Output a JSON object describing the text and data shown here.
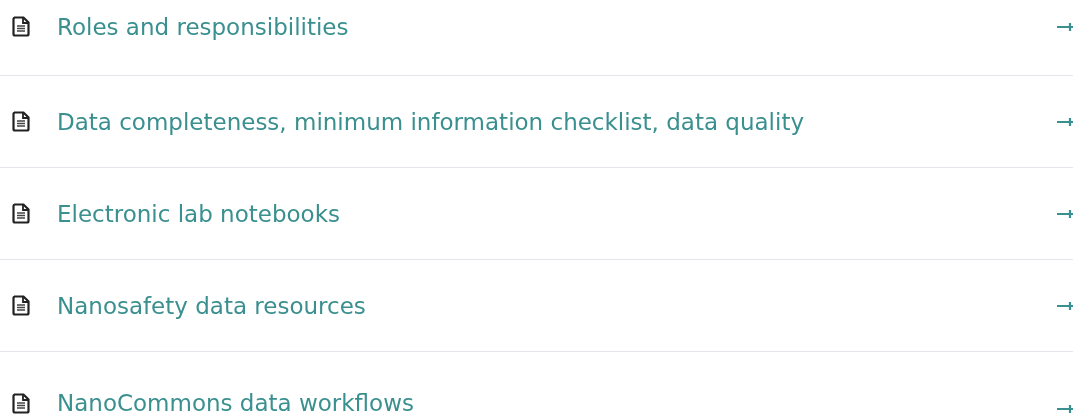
{
  "links": [
    {
      "label": "Roles and responsibilities"
    },
    {
      "label": "Data completeness, minimum information checklist, data quality"
    },
    {
      "label": "Electronic lab notebooks"
    },
    {
      "label": "Nanosafety data resources"
    },
    {
      "label": "NanoCommons data workflows"
    }
  ]
}
